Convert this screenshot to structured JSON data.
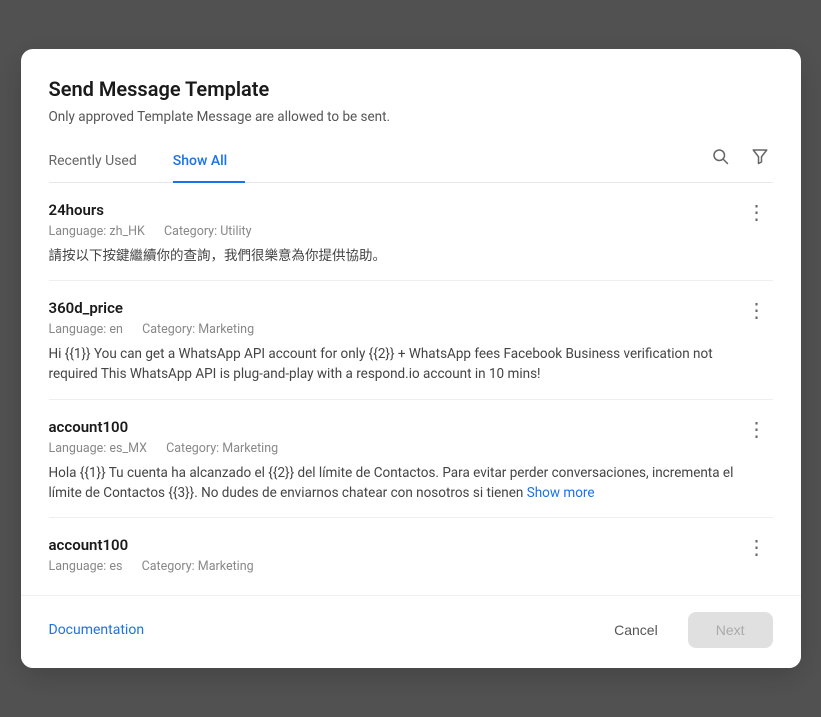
{
  "modal": {
    "title": "Send Message Template",
    "subtitle": "Only approved Template Message are allowed to be sent.",
    "tabs": [
      {
        "id": "recently-used",
        "label": "Recently Used",
        "active": false
      },
      {
        "id": "show-all",
        "label": "Show All",
        "active": true
      }
    ],
    "icons": {
      "search": "🔍",
      "filter": "⛉"
    },
    "templates": [
      {
        "id": "t1",
        "name": "24hours",
        "language": "Language: zh_HK",
        "category": "Category: Utility",
        "body": "請按以下按鍵繼續你的查詢，我們很樂意為你提供協助。",
        "has_show_more": false
      },
      {
        "id": "t2",
        "name": "360d_price",
        "language": "Language: en",
        "category": "Category: Marketing",
        "body": "Hi {{1}} You can get a WhatsApp API account for only {{2}} + WhatsApp fees Facebook Business verification not required This WhatsApp API is plug-and-play with a respond.io account in 10 mins!",
        "has_show_more": false
      },
      {
        "id": "t3",
        "name": "account100",
        "language": "Language: es_MX",
        "category": "Category: Marketing",
        "body": "Hola {{1}} Tu cuenta ha alcanzado el {{2}} del límite de Contactos. Para evitar perder conversaciones, incrementa el límite de Contactos {{3}}. No dudes de enviarnos chatear con nosotros si tienen",
        "has_show_more": true,
        "show_more_label": "Show more"
      },
      {
        "id": "t4",
        "name": "account100",
        "language": "Language: es",
        "category": "Category: Marketing",
        "body": "",
        "has_show_more": false
      }
    ],
    "footer": {
      "doc_link": "Documentation",
      "cancel_label": "Cancel",
      "next_label": "Next"
    }
  }
}
